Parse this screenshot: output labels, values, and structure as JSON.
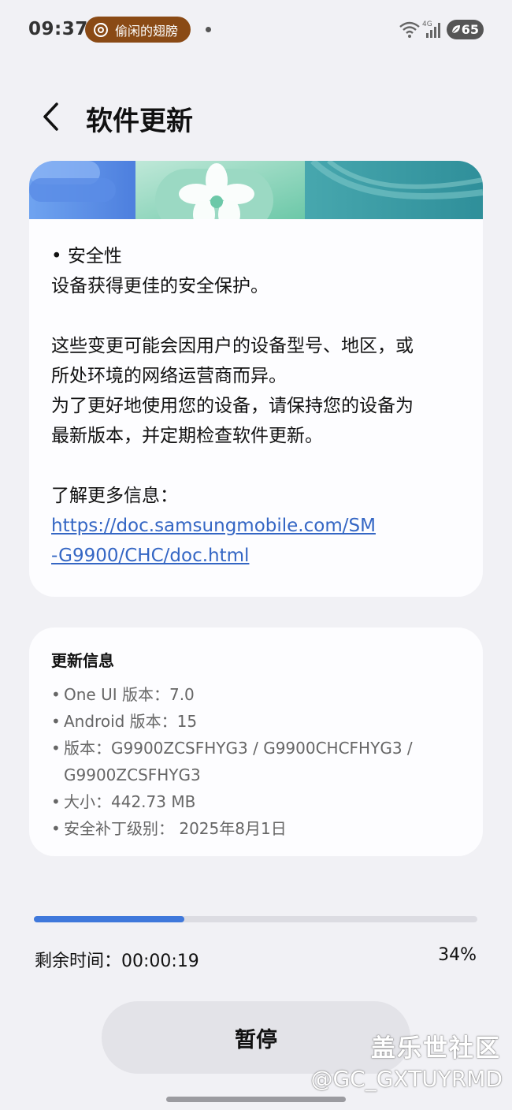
{
  "status_bar": {
    "time": "09:37",
    "now_playing": "偷闲的翅膀",
    "network_label": "4G",
    "battery": "65"
  },
  "header": {
    "title": "软件更新"
  },
  "release_notes": {
    "lines": [
      "• 安全性",
      "设备获得更佳的安全保护。",
      "",
      "这些变更可能会因用户的设备型号、地区，或",
      "所处环境的网络运营商而异。",
      "为了更好地使用您的设备，请保持您的设备为",
      "最新版本，并定期检查软件更新。",
      "",
      "了解更多信息："
    ],
    "link_line1": "https://doc.samsungmobile.com/SM",
    "link_line2": "-G9900/CHC/doc.html"
  },
  "update_info": {
    "title": "更新信息",
    "items": [
      {
        "bullet": "•",
        "text": "One UI 版本：7.0"
      },
      {
        "bullet": "•",
        "text": "Android 版本：15"
      },
      {
        "bullet": "•",
        "text": "版本：G9900ZCSFHYG3 / G9900CHCFHYG3 /"
      },
      {
        "bullet": "",
        "text": "G9900ZCSFHYG3"
      },
      {
        "bullet": "•",
        "text": "大小：442.73 MB"
      },
      {
        "bullet": "•",
        "text": "安全补丁级别： 2025年8月1日"
      }
    ]
  },
  "progress": {
    "fraction": 0.34,
    "remaining_label": "剩余时间：00:00:19",
    "percent_label": "34%"
  },
  "actions": {
    "pause_label": "暂停"
  },
  "watermark": {
    "site": "盖乐世社区",
    "user": "@GC_GXTUYRMD"
  },
  "colors": {
    "accent": "#3f78db",
    "link": "#3466c4",
    "music_pill": "#8a4a15"
  }
}
